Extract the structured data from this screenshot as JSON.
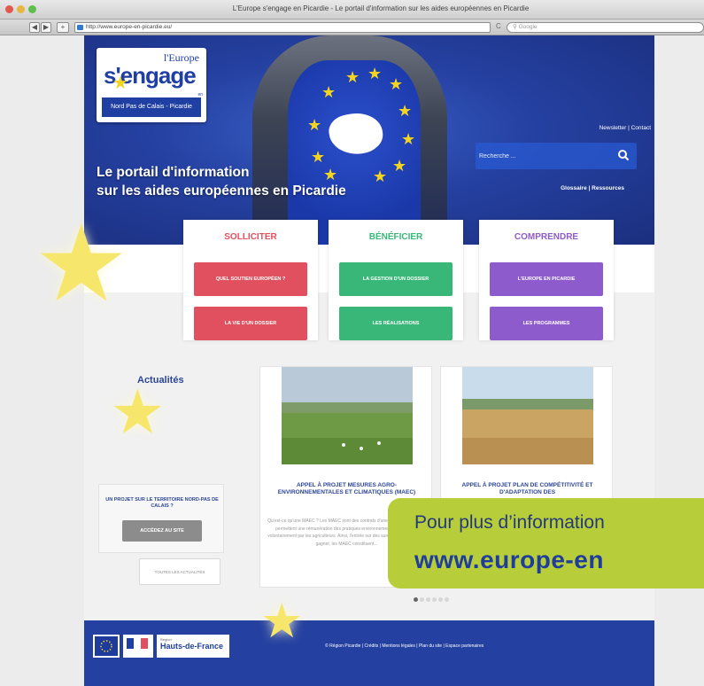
{
  "browser": {
    "window_title": "L'Europe s'engage en Picardie - Le portail d'information sur les aides européennes en Picardie",
    "url": "http://www.europe-en-picardie.eu/",
    "search_placeholder": "Google",
    "back_label": "◀",
    "forward_label": "▶",
    "add_label": "+",
    "reload_label": "C"
  },
  "header": {
    "logo_line1": "l'Europe",
    "logo_line2": "s'engage",
    "logo_en": "en",
    "logo_region": "Nord Pas de Calais - Picardie",
    "tagline_line1": "Le portail d'information",
    "tagline_line2": "sur les aides européennes en Picardie",
    "top_links": "Newsletter | Contact",
    "search_placeholder": "Recherche ...",
    "secondary_links": "Glossaire | Ressources"
  },
  "categories": [
    {
      "title": "SOLLICITER",
      "color": "#e0505e",
      "buttons": [
        "QUEL SOUTIEN EUROPÉEN ?",
        "LA VIE D'UN DOSSIER"
      ]
    },
    {
      "title": "BÉNÉFICIER",
      "color": "#38b779",
      "buttons": [
        "LA GESTION D'UN DOSSIER",
        "LES RÉALISATIONS"
      ]
    },
    {
      "title": "COMPRENDRE",
      "color": "#8d5bcc",
      "buttons": [
        "L'EUROPE EN PICARDIE",
        "LES PROGRAMMES"
      ]
    }
  ],
  "news": {
    "heading": "Actualités",
    "project_box_text": "UN PROJET SUR LE TERRITOIRE NORD-PAS DE CALAIS ?",
    "project_box_button": "ACCÉDEZ AU SITE",
    "all_news_button": "TOUTES LES ACTUALITÉS",
    "cards": [
      {
        "title": "APPEL À PROJET MESURES AGRO-ENVIRONNEMENTALES ET CLIMATIQUES (MAEC)",
        "text": "Qu'est-ce qu'une MAEC ? Les MAEC sont des contrats d'une durée de 5 ans qui permettent une rémunération des pratiques environnementales réalisées volontairement par les agriculteurs. Ainsi, l'entrée sur des surcoûts et manques à gagner, les MAEC constituent..."
      },
      {
        "title": "APPEL À PROJET PLAN DE COMPÉTITIVITÉ ET D'ADAPTATION DES",
        "text": ""
      }
    ]
  },
  "footer": {
    "region_name": "Hauts-de-France",
    "region_prefix": "Région",
    "links": "© Région Picardie  |  Crédits  |  Mentions légales  |  Plan du site  |  Espace partenaires"
  },
  "overlay": {
    "line1": "Pour plus d’information",
    "line2": "www.europe-en"
  },
  "colors": {
    "brand_blue": "#2440a0",
    "accent_yellow": "#f3d421",
    "overlay_green": "#b7cd3a"
  }
}
